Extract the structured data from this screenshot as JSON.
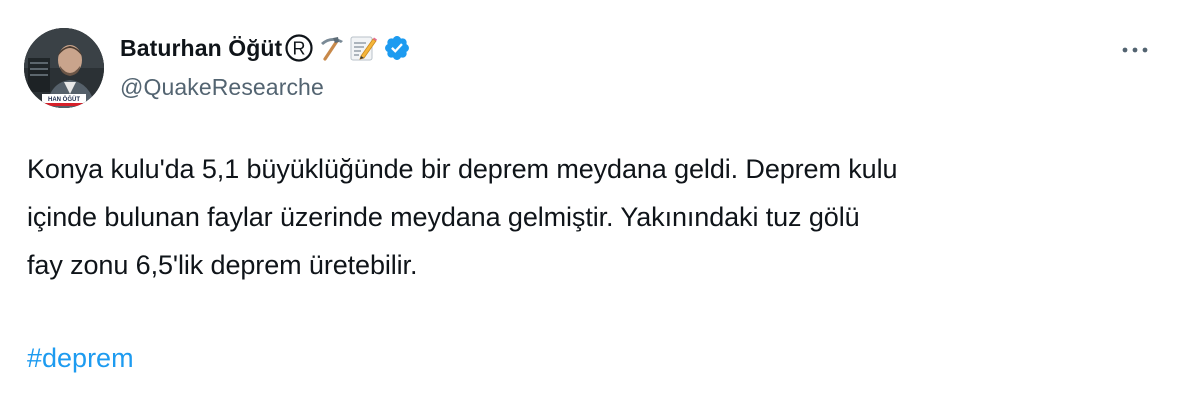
{
  "author": {
    "display_name": "Baturhan Öğüt",
    "handle": "@QuakeResearche",
    "avatar_caption": "HAN ÖĞÜT",
    "name_icons": [
      "registered-icon",
      "pick-icon",
      "memo-icon"
    ],
    "verified": true
  },
  "tweet": {
    "text": "Konya kulu'da 5,1 büyüklüğünde bir deprem meydana geldi. Deprem kulu\niçinde bulunan faylar üzerinde meydana gelmiştir. Yakınındaki tuz gölü\nfay zonu 6,5'lik deprem üretebilir.",
    "hashtag": "#deprem"
  },
  "colors": {
    "text": "#0f1419",
    "secondary": "#536471",
    "link": "#1d9bf0",
    "verified": "#1d9bf0"
  }
}
